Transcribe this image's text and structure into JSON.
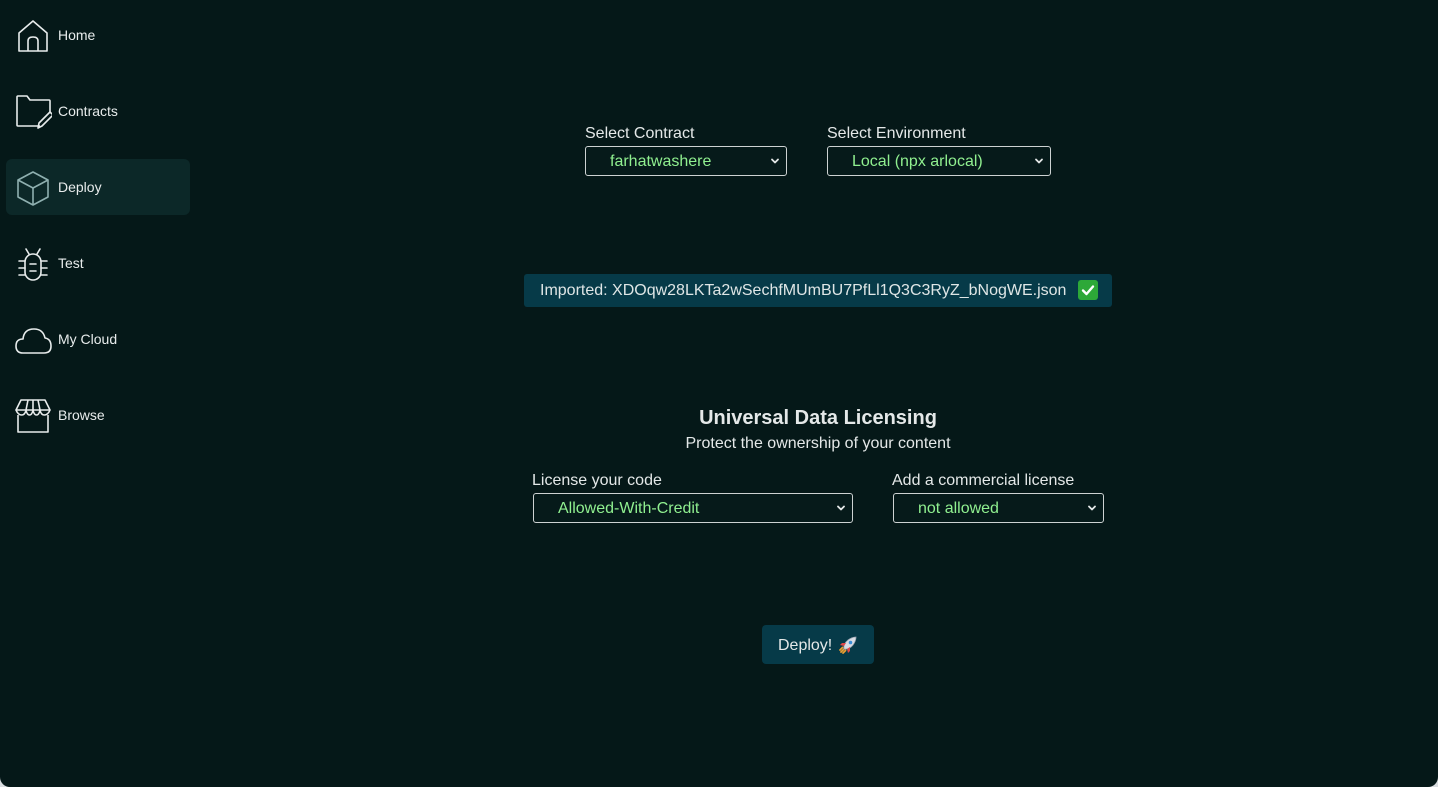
{
  "sidebar": {
    "items": [
      {
        "label": "Home",
        "icon": "home-icon"
      },
      {
        "label": "Contracts",
        "icon": "folder-edit-icon"
      },
      {
        "label": "Deploy",
        "icon": "cube-icon",
        "active": true
      },
      {
        "label": "Test",
        "icon": "bug-icon"
      },
      {
        "label": "My Cloud",
        "icon": "cloud-icon"
      },
      {
        "label": "Browse",
        "icon": "store-icon"
      }
    ]
  },
  "deploy": {
    "contract_label": "Select Contract",
    "contract_value": "farhatwashere",
    "environment_label": "Select Environment",
    "environment_value": "Local (npx arlocal)",
    "imported_text": "Imported: XDOqw28LKTa2wSechfMUmBU7PfLl1Q3C3RyZ_bNogWE.json",
    "imported_status_icon": "check-icon",
    "licensing_title": "Universal Data Licensing",
    "licensing_subtitle": "Protect the ownership of your content",
    "license_label": "License your code",
    "license_value": "Allowed-With-Credit",
    "commercial_label": "Add a commercial license",
    "commercial_value": "not allowed",
    "deploy_button": "Deploy!",
    "deploy_button_icon": "rocket-icon"
  },
  "colors": {
    "background": "#051818",
    "active_nav": "#0c2828",
    "accent_box": "#063a48",
    "select_value": "#90f090"
  }
}
